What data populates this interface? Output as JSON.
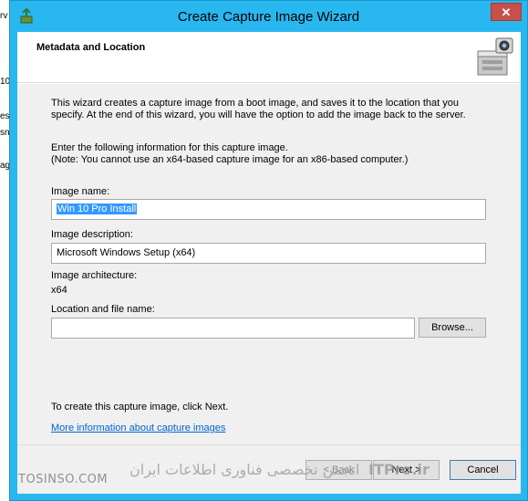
{
  "background_window": {
    "fragments": [
      "rv",
      "10",
      "es",
      "sn",
      "ag"
    ]
  },
  "window": {
    "title": "Create Capture Image Wizard",
    "close_glyph": "✕"
  },
  "header": {
    "title": "Metadata and Location"
  },
  "content": {
    "intro_line1": "This wizard creates a capture image from a boot image, and saves it to the location that you",
    "intro_line2": "specify. At the end of this wizard, you will have the option to add the image back to the server.",
    "enter_line1": "Enter the following information for this capture image.",
    "enter_line2": "(Note: You cannot use an x64-based capture image for an x86-based computer.)",
    "image_name_label": "Image name:",
    "image_name_value": "Win 10 Pro Install",
    "image_description_label": "Image description:",
    "image_description_value": "Microsoft Windows Setup (x64)",
    "architecture_label": "Image architecture:",
    "architecture_value": "x64",
    "location_label": "Location and file name:",
    "location_value": "",
    "browse_label": "Browse...",
    "next_hint": "To create this capture image, click Next.",
    "more_info_link": "More information about capture images"
  },
  "footer": {
    "back_label": "< Back",
    "next_label": "Next >",
    "cancel_label": "Cancel"
  },
  "watermark": {
    "site_left": "TOSINSO.COM",
    "site_right": "ITPro.ir",
    "persian_text": "انجمن تخصصی فناوری اطلاعات ایران"
  },
  "colors": {
    "window_frame": "#29b7f0",
    "close_button": "#c7504b",
    "link": "#0066cc",
    "selection": "#3399ff"
  }
}
